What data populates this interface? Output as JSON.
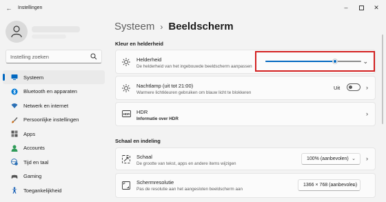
{
  "window": {
    "title": "Instellingen",
    "back_icon": "back-arrow-icon",
    "controls": {
      "minimize": "minimize-icon",
      "maximize": "maximize-icon",
      "close": "close-icon"
    }
  },
  "sidebar": {
    "search_placeholder": "Instelling zoeken",
    "items": [
      {
        "label": "Systeem",
        "icon": "monitor-icon",
        "active": true,
        "color": "#0067c0"
      },
      {
        "label": "Bluetooth en apparaten",
        "icon": "bluetooth-icon",
        "active": false,
        "color": "#0078d4"
      },
      {
        "label": "Netwerk en internet",
        "icon": "wifi-icon",
        "active": false,
        "color": "#2a6fb5"
      },
      {
        "label": "Persoonlijke instellingen",
        "icon": "brush-icon",
        "active": false,
        "color": "#c8701f"
      },
      {
        "label": "Apps",
        "icon": "apps-icon",
        "active": false,
        "color": "#555555"
      },
      {
        "label": "Accounts",
        "icon": "person-icon",
        "active": false,
        "color": "#2f9b58"
      },
      {
        "label": "Tijd en taal",
        "icon": "globe-clock-icon",
        "active": false,
        "color": "#2a6fb5"
      },
      {
        "label": "Gaming",
        "icon": "gamepad-icon",
        "active": false,
        "color": "#555555"
      },
      {
        "label": "Toegankelijkheid",
        "icon": "accessibility-icon",
        "active": false,
        "color": "#1c63b7"
      }
    ]
  },
  "breadcrumb": {
    "parent": "Systeem",
    "separator": "›",
    "current": "Beeldscherm"
  },
  "sections": {
    "color_brightness": "Kleur en helderheid",
    "scale_layout": "Schaal en indeling"
  },
  "brightness": {
    "title": "Helderheid",
    "subtitle": "De helderheid van het ingebouwde beeldscherm aanpassen",
    "value": 0.73
  },
  "nightlight": {
    "title": "Nachtlamp (uit tot 21:00)",
    "subtitle": "Warmere lichtkleuren gebruiken om blauw licht te blokkeren",
    "toggle_label": "Uit",
    "on": false
  },
  "hdr": {
    "title": "HDR",
    "subtitle": "Informatie over HDR"
  },
  "scale": {
    "title": "Schaal",
    "subtitle": "De grootte van tekst, apps en andere items wijzigen",
    "value": "100% (aanbevolen)"
  },
  "resolution": {
    "title": "Schermresolutie",
    "subtitle": "Pas de resolutie aan het aangesloten beeldscherm aan",
    "value": "1366 × 768 (aanbevolen)"
  },
  "accent_color": "#0067c0",
  "highlight_color": "#d31f1f"
}
